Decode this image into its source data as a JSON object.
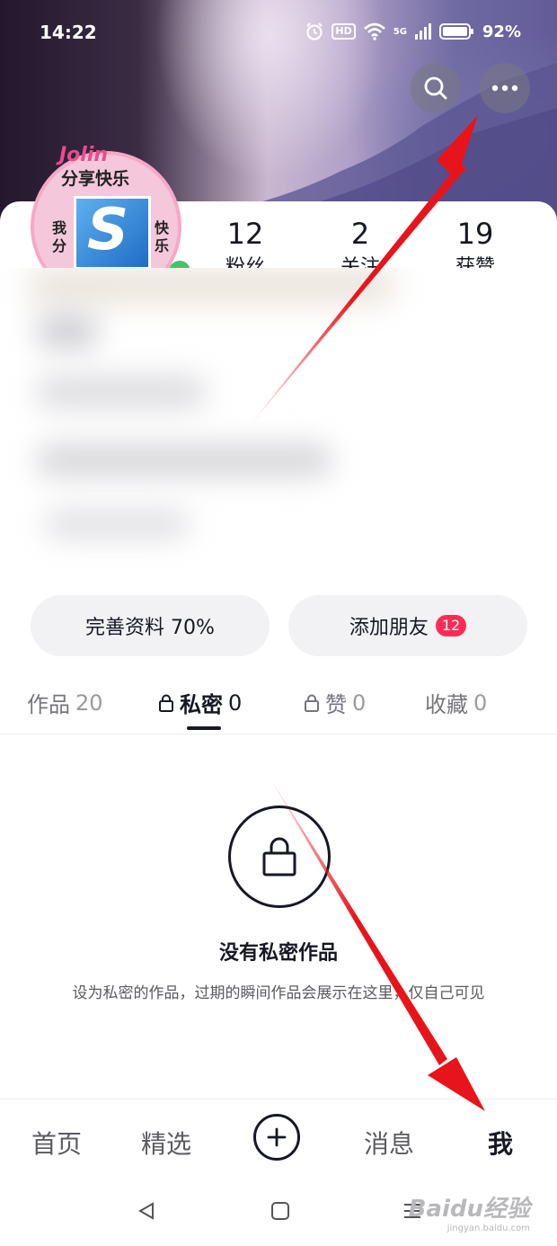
{
  "status_bar": {
    "time": "14:22",
    "network": "5G",
    "hd": "HD",
    "battery": "92%"
  },
  "header": {
    "search_icon": "search-icon",
    "more_icon": "more-dots-icon"
  },
  "avatar": {
    "title": "Jolin",
    "subtitle": "分享快乐",
    "side_left": "我分",
    "side_right": "快乐",
    "logo_letter": "S"
  },
  "stats": [
    {
      "num": "12",
      "label": "粉丝"
    },
    {
      "num": "2",
      "label": "关注"
    },
    {
      "num": "19",
      "label": "获赞"
    }
  ],
  "actions": {
    "profile_label": "完善资料 70%",
    "add_friend_label": "添加朋友",
    "add_friend_badge": "12"
  },
  "tabs": [
    {
      "label": "作品",
      "count": "20",
      "locked": false,
      "active": false
    },
    {
      "label": "私密",
      "count": "0",
      "locked": true,
      "active": true
    },
    {
      "label": "赞",
      "count": "0",
      "locked": true,
      "active": false
    },
    {
      "label": "收藏",
      "count": "0",
      "locked": false,
      "active": false
    }
  ],
  "empty_state": {
    "title": "没有私密作品",
    "description": "设为私密的作品，过期的瞬间作品会展示在这里，仅自己可见"
  },
  "bottom_nav": {
    "home": "首页",
    "featured": "精选",
    "messages": "消息",
    "me": "我"
  },
  "watermark": {
    "brand": "Baidu经验",
    "url": "jingyan.baidu.com"
  },
  "colors": {
    "accent": "#fe2c55",
    "text": "#161823",
    "arrow": "#e8141b"
  }
}
